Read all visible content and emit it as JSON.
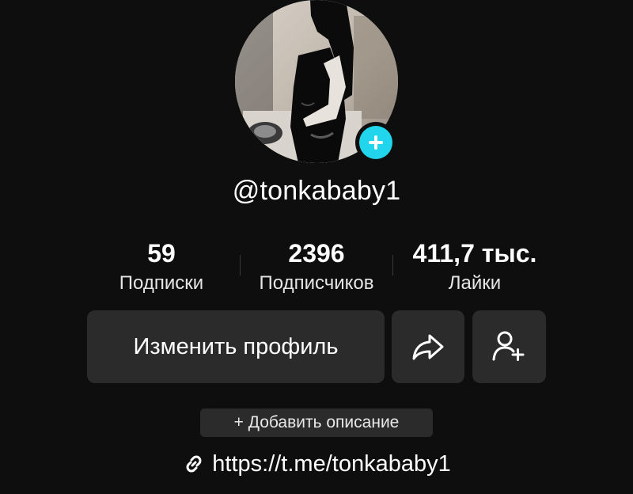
{
  "profile": {
    "username": "@tonkababy1",
    "add_avatar_icon": "plus-icon"
  },
  "stats": {
    "following": {
      "value": "59",
      "label": "Подписки"
    },
    "followers": {
      "value": "2396",
      "label": "Подписчиков"
    },
    "likes": {
      "value": "411,7 тыс.",
      "label": "Лайки"
    }
  },
  "actions": {
    "edit_profile_label": "Изменить профиль",
    "share_icon": "share-arrow-icon",
    "add_friend_icon": "add-person-icon"
  },
  "bio": {
    "add_description_label": "+ Добавить описание"
  },
  "link": {
    "icon": "link-icon",
    "text": "https://t.me/tonkababy1"
  },
  "colors": {
    "background": "#0e0e0e",
    "button": "#2b2b2b",
    "accent": "#20d5ec"
  }
}
